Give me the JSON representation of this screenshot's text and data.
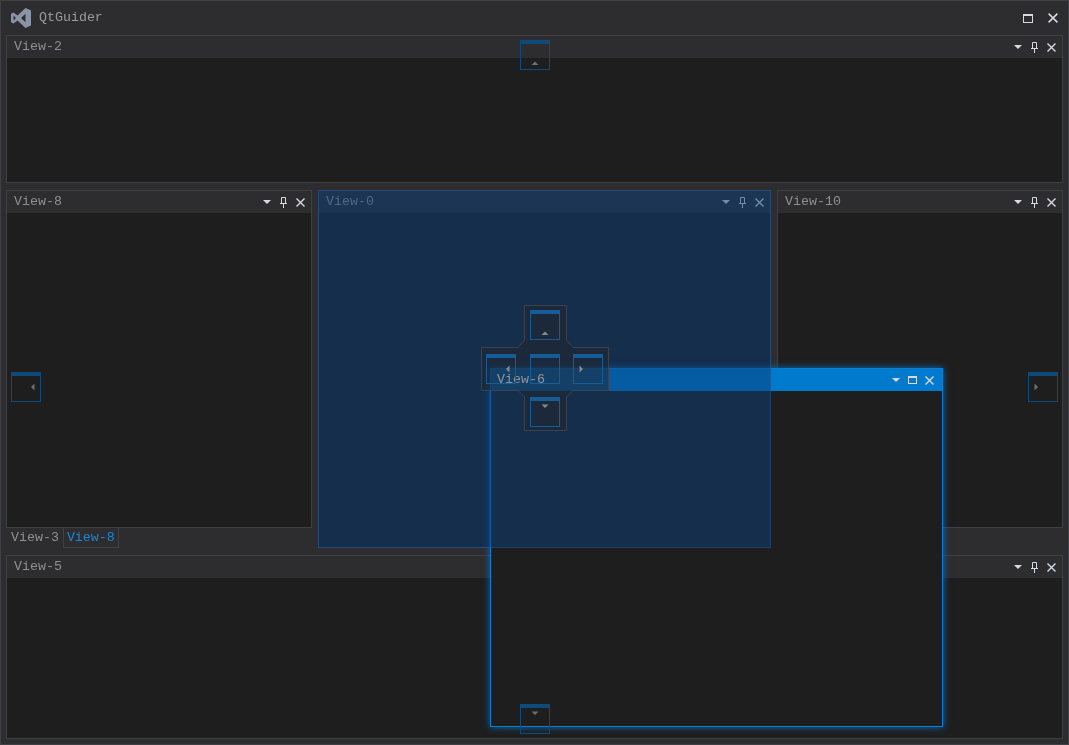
{
  "window": {
    "title": "QtGuider"
  },
  "top_area": {
    "title": "View-2",
    "drop_target": false
  },
  "middle_areas": [
    {
      "title": "View-8",
      "drop_target": false,
      "tabs": [
        {
          "label": "View-3",
          "selected": false
        },
        {
          "label": "View-8",
          "selected": true
        }
      ]
    },
    {
      "title": "View-0",
      "drop_target": true
    },
    {
      "title": "View-10",
      "drop_target": false
    }
  ],
  "bottom_area": {
    "title": "View-5",
    "drop_target": false
  },
  "floating_window": {
    "title": "View-6"
  }
}
